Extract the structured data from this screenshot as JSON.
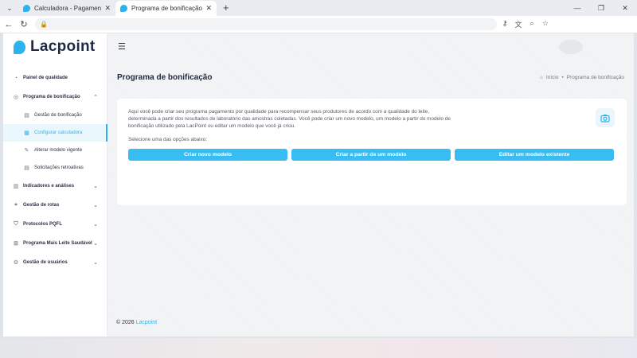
{
  "browser": {
    "tabs": [
      {
        "title": "Calculadora - Pagamento por qual",
        "active": false
      },
      {
        "title": "Programa de bonificação - Lacpoi",
        "active": true
      }
    ],
    "new_tab": "+",
    "tab_menu": "⌄",
    "close_symbol": "✕",
    "window_controls": [
      "—",
      "❐",
      "✕"
    ]
  },
  "app": {
    "logo_text": "Lacpoint",
    "menu_icon": "☰",
    "sidebar": [
      {
        "label": "Painel de qualidade",
        "icon": "gauge-icon",
        "chevron": ""
      },
      {
        "label": "Programa de bonificação",
        "icon": "coin-icon",
        "chevron": "⌃",
        "children": [
          {
            "label": "Gestão de bonificação",
            "icon": "document-icon",
            "active": false
          },
          {
            "label": "Configurar calculadora",
            "icon": "calculator-icon",
            "active": true
          },
          {
            "label": "Alterar modelo vigente",
            "icon": "edit-icon",
            "active": false
          },
          {
            "label": "Solicitações retroativas",
            "icon": "document-icon",
            "active": false
          }
        ]
      },
      {
        "label": "Indicadores e análises",
        "icon": "chart-icon",
        "chevron": "⌄"
      },
      {
        "label": "Gestão de rotas",
        "icon": "pin-icon",
        "chevron": "⌄"
      },
      {
        "label": "Protocolos PQFL",
        "icon": "shield-icon",
        "chevron": "⌄"
      },
      {
        "label": "Programa Mais Leite Saudável",
        "icon": "grid-icon",
        "chevron": "⌄"
      },
      {
        "label": "Gestão de usuários",
        "icon": "gear-icon",
        "chevron": "⌄"
      }
    ]
  },
  "page": {
    "title": "Programa de bonificação",
    "breadcrumb": {
      "home": "Início",
      "separator": "•",
      "current": "Programa de bonificação"
    },
    "description": "Aqui você pode criar seu programa pagamento por qualidade para recompensar seus produtores de acordo com a qualidade do leite, determinada a partir dos resultados de laboratório das amostras coletadas. Você pode criar um novo modelo, um modelo a partir do modelo de bonificação utilizado pela LacPoint ou editar um modelo que você já criou.",
    "prompt": "Selecione uma das opções abaixo:",
    "buttons": {
      "new_model": "Criar novo modelo",
      "from_model": "Criar a partir de um modelo",
      "edit_model": "Editar um modelo existente"
    }
  },
  "footer": {
    "copyright": "© 2026",
    "brand": "Lacpoint"
  },
  "colors": {
    "accent": "#2bb3ee",
    "button": "#38bdf2",
    "title": "#1e2a44"
  }
}
